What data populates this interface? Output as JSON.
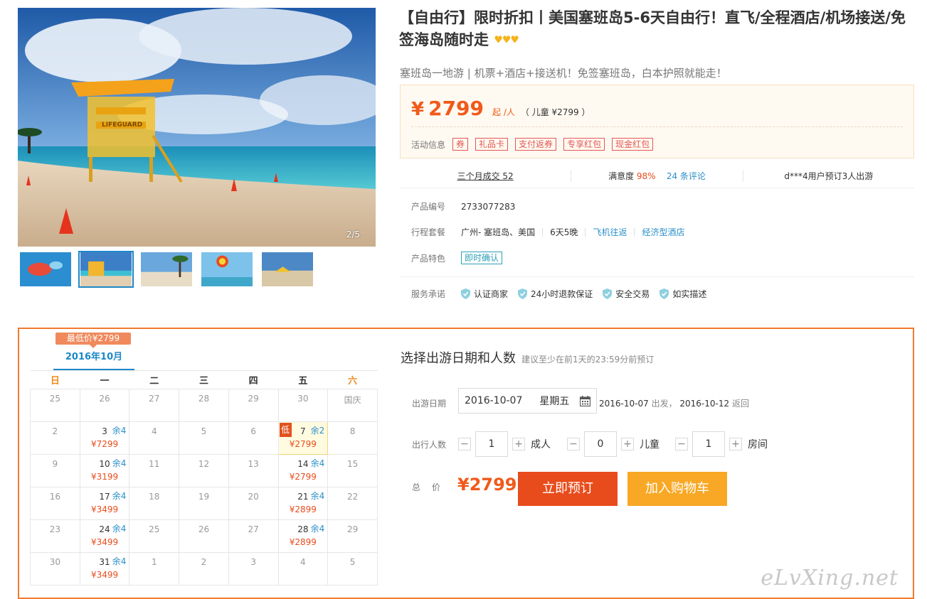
{
  "gallery": {
    "counter": "2/5",
    "lifeguard_sign": "LIFEGUARD"
  },
  "product": {
    "title": "【自由行】限时折扣丨美国塞班岛5-6天自由行！直飞/全程酒店/机场接送/免签海岛随时走",
    "crowns": "♥♥♥",
    "subtitle": "塞班岛一地游 | 机票+酒店+接送机！免签塞班岛，白本护照就能走！"
  },
  "price": {
    "currency": "¥",
    "amount": "2799",
    "unit": "起 /人",
    "child": "（ 儿童 ¥2799 ）"
  },
  "promo": {
    "label": "活动信息",
    "tags": [
      "券",
      "礼品卡",
      "支付返券",
      "专享红包",
      "现金红包"
    ]
  },
  "stats": {
    "sales": "三个月成交 52",
    "satisfaction_label": "满意度 ",
    "satisfaction_value": "98%",
    "reviews": "24 条评论",
    "recent": "d***4用户预订3人出游"
  },
  "info": {
    "code_label": "产品编号",
    "code_value": "2733077283",
    "package_label": "行程套餐",
    "route": "广州- 塞班岛、美国",
    "duration": "6天5晚",
    "flight": "飞机往返",
    "hotel": "经济型酒店",
    "feature_label": "产品特色",
    "feature_tag": "即时确认"
  },
  "service": {
    "label": "服务承诺",
    "items": [
      "认证商家",
      "24小时退款保证",
      "安全交易",
      "如实描述"
    ]
  },
  "calendar": {
    "low_badge": "最低价¥2799",
    "month": "2016年10月",
    "weekdays": [
      "日",
      "一",
      "二",
      "三",
      "四",
      "五",
      "六"
    ],
    "rows": [
      [
        {
          "d": "25"
        },
        {
          "d": "26"
        },
        {
          "d": "27"
        },
        {
          "d": "28"
        },
        {
          "d": "29"
        },
        {
          "d": "30"
        },
        {
          "d": "国庆"
        }
      ],
      [
        {
          "d": "2"
        },
        {
          "d": "3",
          "r": "余4",
          "p": "¥7299"
        },
        {
          "d": "4"
        },
        {
          "d": "5"
        },
        {
          "d": "6"
        },
        {
          "d": "7",
          "r": "余2",
          "p": "¥2799",
          "sel": true,
          "low": "低"
        },
        {
          "d": "8"
        }
      ],
      [
        {
          "d": "9"
        },
        {
          "d": "10",
          "r": "余4",
          "p": "¥3199"
        },
        {
          "d": "11"
        },
        {
          "d": "12"
        },
        {
          "d": "13"
        },
        {
          "d": "14",
          "r": "余4",
          "p": "¥2799"
        },
        {
          "d": "15"
        }
      ],
      [
        {
          "d": "16"
        },
        {
          "d": "17",
          "r": "余4",
          "p": "¥3499"
        },
        {
          "d": "18"
        },
        {
          "d": "19"
        },
        {
          "d": "20"
        },
        {
          "d": "21",
          "r": "余4",
          "p": "¥2899"
        },
        {
          "d": "22"
        }
      ],
      [
        {
          "d": "23"
        },
        {
          "d": "24",
          "r": "余4",
          "p": "¥3499"
        },
        {
          "d": "25"
        },
        {
          "d": "26"
        },
        {
          "d": "27"
        },
        {
          "d": "28",
          "r": "余4",
          "p": "¥2899"
        },
        {
          "d": "29"
        }
      ],
      [
        {
          "d": "30"
        },
        {
          "d": "31",
          "r": "余4",
          "p": "¥3499"
        },
        {
          "d": "1"
        },
        {
          "d": "2"
        },
        {
          "d": "3"
        },
        {
          "d": "4"
        },
        {
          "d": "5"
        }
      ]
    ]
  },
  "booking": {
    "title": "选择出游日期和人数",
    "hint": "建议至少在前1天的23:59分前预订",
    "date_label": "出游日期",
    "date_value": "2016-10-07",
    "weekday": "星期五",
    "depart_date": "2016-10-07",
    "depart_text": " 出发， ",
    "return_date": "2016-10-12",
    "return_text": " 返回",
    "people_label": "出行人数",
    "adults": "1",
    "adults_unit": "成人",
    "children": "0",
    "children_unit": "儿童",
    "rooms": "1",
    "rooms_unit": "房间",
    "minus": "−",
    "plus": "+",
    "total_label": "总价",
    "total_value": "¥2799",
    "book_button": "立即预订",
    "cart_button": "加入购物车"
  },
  "watermark": "eLvXing.net",
  "colors": {
    "accent_orange": "#e94c1c",
    "cart_yellow": "#f8a825",
    "link_blue": "#2b8fc8",
    "panel_border": "#ef7b2f"
  }
}
